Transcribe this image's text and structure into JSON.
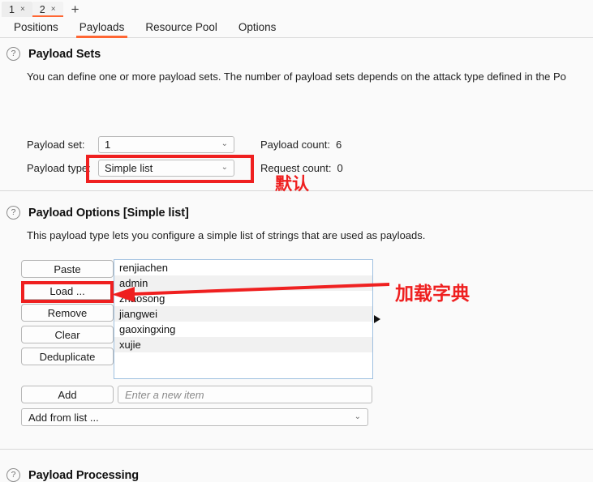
{
  "window": {
    "request_tabs": [
      {
        "label": "1",
        "close": "×",
        "active": false
      },
      {
        "label": "2",
        "close": "×",
        "active": true
      }
    ],
    "add_tab_label": "+"
  },
  "nav_tabs": [
    {
      "label": "Positions",
      "active": false
    },
    {
      "label": "Payloads",
      "active": true
    },
    {
      "label": "Resource Pool",
      "active": false
    },
    {
      "label": "Options",
      "active": false
    }
  ],
  "help_icon": "?",
  "payload_sets": {
    "title": "Payload Sets",
    "description": "You can define one or more payload sets. The number of payload sets depends on the attack type defined in the Po",
    "payload_set_label": "Payload set:",
    "payload_set_value": "1",
    "payload_type_label": "Payload type:",
    "payload_type_value": "Simple list",
    "payload_count_label": "Payload count:",
    "payload_count_value": "6",
    "request_count_label": "Request count:",
    "request_count_value": "0",
    "chevron": "⌄"
  },
  "payload_options": {
    "title": "Payload Options [Simple list]",
    "description": "This payload type lets you configure a simple list of strings that are used as payloads.",
    "buttons": [
      {
        "label": "Paste"
      },
      {
        "label": "Load ..."
      },
      {
        "label": "Remove"
      },
      {
        "label": "Clear"
      },
      {
        "label": "Deduplicate"
      }
    ],
    "items": [
      "renjiachen",
      "admin",
      "zhaosong",
      "jiangwei",
      "gaoxingxing",
      "xujie"
    ],
    "add_button_label": "Add",
    "new_item_placeholder": "Enter a new item",
    "add_from_list_label": "Add from list ...",
    "chevron": "⌄"
  },
  "payload_processing": {
    "title": "Payload Processing"
  },
  "annotations": {
    "default_note": "默认",
    "load_dict_note": "加载字典",
    "highlight_color": "#ef2020"
  }
}
